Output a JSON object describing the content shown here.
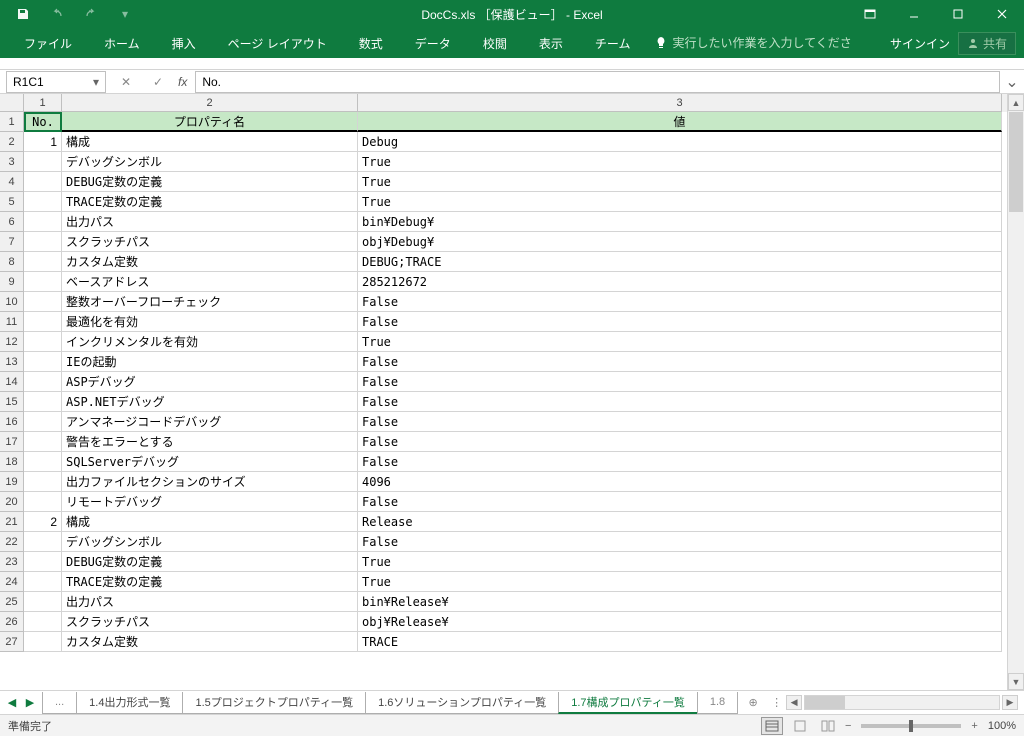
{
  "title": "DocCs.xls ［保護ビュー］ - Excel",
  "qat": {
    "save": "save",
    "undo": "undo",
    "redo": "redo"
  },
  "tabs": [
    "ファイル",
    "ホーム",
    "挿入",
    "ページ レイアウト",
    "数式",
    "データ",
    "校閲",
    "表示",
    "チーム"
  ],
  "tell_me_placeholder": "実行したい作業を入力してください",
  "signin": "サインイン",
  "share": "共有",
  "name_box": "R1C1",
  "formula": "No.",
  "col_headers": [
    "1",
    "2",
    "3"
  ],
  "header_row": {
    "no": "No.",
    "prop": "プロパティ名",
    "val": "値"
  },
  "rows": [
    {
      "r": "2",
      "no": "1",
      "prop": "構成",
      "val": "Debug"
    },
    {
      "r": "3",
      "no": "",
      "prop": "デバッグシンボル",
      "val": "True"
    },
    {
      "r": "4",
      "no": "",
      "prop": "DEBUG定数の定義",
      "val": "True"
    },
    {
      "r": "5",
      "no": "",
      "prop": "TRACE定数の定義",
      "val": "True"
    },
    {
      "r": "6",
      "no": "",
      "prop": "出力パス",
      "val": "bin¥Debug¥"
    },
    {
      "r": "7",
      "no": "",
      "prop": "スクラッチパス",
      "val": "obj¥Debug¥"
    },
    {
      "r": "8",
      "no": "",
      "prop": "カスタム定数",
      "val": "DEBUG;TRACE"
    },
    {
      "r": "9",
      "no": "",
      "prop": "ベースアドレス",
      "val": "285212672"
    },
    {
      "r": "10",
      "no": "",
      "prop": "整数オーバーフローチェック",
      "val": "False"
    },
    {
      "r": "11",
      "no": "",
      "prop": "最適化を有効",
      "val": "False"
    },
    {
      "r": "12",
      "no": "",
      "prop": "インクリメンタルを有効",
      "val": "True"
    },
    {
      "r": "13",
      "no": "",
      "prop": "IEの起動",
      "val": "False"
    },
    {
      "r": "14",
      "no": "",
      "prop": "ASPデバッグ",
      "val": "False"
    },
    {
      "r": "15",
      "no": "",
      "prop": "ASP.NETデバッグ",
      "val": "False"
    },
    {
      "r": "16",
      "no": "",
      "prop": "アンマネージコードデバッグ",
      "val": "False"
    },
    {
      "r": "17",
      "no": "",
      "prop": "警告をエラーとする",
      "val": "False"
    },
    {
      "r": "18",
      "no": "",
      "prop": "SQLServerデバッグ",
      "val": "False"
    },
    {
      "r": "19",
      "no": "",
      "prop": "出力ファイルセクションのサイズ",
      "val": "4096"
    },
    {
      "r": "20",
      "no": "",
      "prop": "リモートデバッグ",
      "val": "False"
    },
    {
      "r": "21",
      "no": "2",
      "prop": "構成",
      "val": "Release"
    },
    {
      "r": "22",
      "no": "",
      "prop": "デバッグシンボル",
      "val": "False"
    },
    {
      "r": "23",
      "no": "",
      "prop": "DEBUG定数の定義",
      "val": "True"
    },
    {
      "r": "24",
      "no": "",
      "prop": "TRACE定数の定義",
      "val": "True"
    },
    {
      "r": "25",
      "no": "",
      "prop": "出力パス",
      "val": "bin¥Release¥"
    },
    {
      "r": "26",
      "no": "",
      "prop": "スクラッチパス",
      "val": "obj¥Release¥"
    },
    {
      "r": "27",
      "no": "",
      "prop": "カスタム定数",
      "val": "TRACE"
    }
  ],
  "sheet_tabs": {
    "prev": "...",
    "items": [
      "1.4出力形式一覧",
      "1.5プロジェクトプロパティ一覧",
      "1.6ソリューションプロパティ一覧",
      "1.7構成プロパティ一覧"
    ],
    "next": "1.8",
    "active_index": 3
  },
  "status": "準備完了",
  "zoom": "100%"
}
